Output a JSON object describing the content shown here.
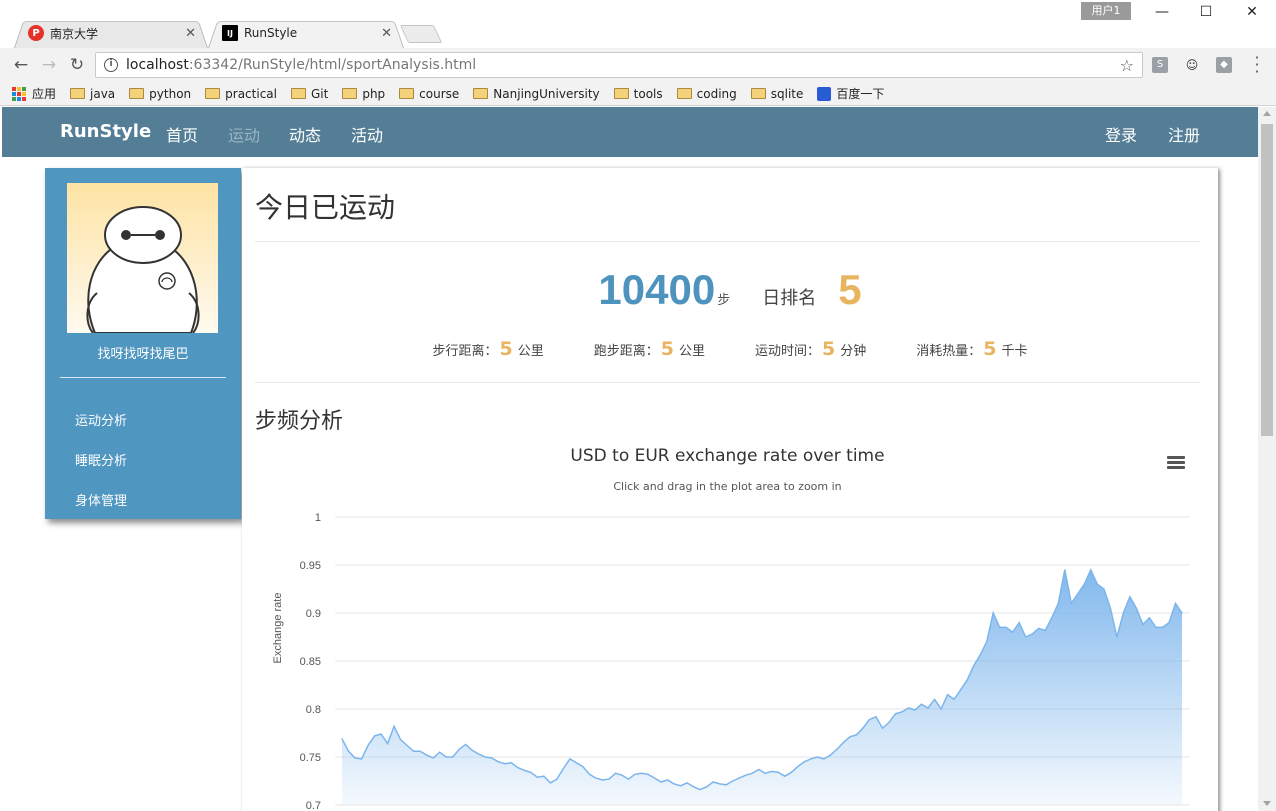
{
  "browser": {
    "tabs": [
      {
        "title": "南京大学",
        "active": false,
        "favicon": "p-icon",
        "favicon_color": "#e5332a"
      },
      {
        "title": "RunStyle",
        "active": true,
        "favicon": "intellij-icon",
        "favicon_color": "#000000"
      }
    ],
    "user_chip": "用户1",
    "url_host": "localhost",
    "url_path": ":63342/RunStyle/html/sportAnalysis.html",
    "bookmarks": [
      {
        "label": "应用",
        "icon": "apps-icon"
      },
      {
        "label": "java",
        "icon": "folder-icon"
      },
      {
        "label": "python",
        "icon": "folder-icon"
      },
      {
        "label": "practical",
        "icon": "folder-icon"
      },
      {
        "label": "Git",
        "icon": "folder-icon"
      },
      {
        "label": "php",
        "icon": "folder-icon"
      },
      {
        "label": "course",
        "icon": "folder-icon"
      },
      {
        "label": "NanjingUniversity",
        "icon": "folder-icon"
      },
      {
        "label": "tools",
        "icon": "folder-icon"
      },
      {
        "label": "coding",
        "icon": "folder-icon"
      },
      {
        "label": "sqlite",
        "icon": "folder-icon"
      },
      {
        "label": "百度一下",
        "icon": "baidu-icon"
      }
    ]
  },
  "nav": {
    "brand": "RunStyle",
    "items": [
      "首页",
      "运动",
      "动态",
      "活动"
    ],
    "current": "运动",
    "login": "登录",
    "register": "注册",
    "bg_color": "#537e96"
  },
  "sidebar": {
    "username": "找呀找呀找尾巴",
    "links": [
      "运动分析",
      "睡眠分析",
      "身体管理"
    ],
    "bg_color": "#4f96c1"
  },
  "main": {
    "title": "今日已运动",
    "steps": "10400",
    "steps_unit": "步",
    "rank_label": "日排名",
    "rank": "5",
    "stats": [
      {
        "label": "步行距离：",
        "value": "5",
        "unit": "公里"
      },
      {
        "label": "跑步距离：",
        "value": "5",
        "unit": "公里"
      },
      {
        "label": "运动时间：",
        "value": "5",
        "unit": "分钟"
      },
      {
        "label": "消耗热量：",
        "value": "5",
        "unit": "千卡"
      }
    ],
    "section_title": "步频分析",
    "accent_blue": "#4e93bd",
    "accent_gold": "#e8b460"
  },
  "chart_data": {
    "type": "area",
    "title": "USD to EUR exchange rate over time",
    "subtitle": "Click and drag in the plot area to zoom in",
    "ylabel": "Exchange rate",
    "xlabel": "",
    "ylim": [
      0.7,
      1.0
    ],
    "yticks": [
      "0.7",
      "0.75",
      "0.8",
      "0.85",
      "0.9",
      "0.95",
      "1"
    ],
    "ytick_values": [
      0.7,
      0.75,
      0.8,
      0.85,
      0.9,
      0.95,
      1.0
    ],
    "grid": true,
    "legend": "none",
    "series": [
      {
        "values": [
          0.769,
          0.756,
          0.749,
          0.748,
          0.762,
          0.772,
          0.774,
          0.764,
          0.782,
          0.768,
          0.762,
          0.756,
          0.756,
          0.752,
          0.749,
          0.755,
          0.75,
          0.75,
          0.758,
          0.763,
          0.757,
          0.753,
          0.75,
          0.749,
          0.745,
          0.743,
          0.744,
          0.739,
          0.736,
          0.734,
          0.729,
          0.73,
          0.723,
          0.727,
          0.738,
          0.748,
          0.744,
          0.74,
          0.732,
          0.728,
          0.726,
          0.727,
          0.733,
          0.731,
          0.727,
          0.732,
          0.733,
          0.732,
          0.728,
          0.724,
          0.726,
          0.722,
          0.72,
          0.723,
          0.719,
          0.716,
          0.719,
          0.724,
          0.722,
          0.721,
          0.725,
          0.728,
          0.731,
          0.733,
          0.737,
          0.733,
          0.735,
          0.734,
          0.73,
          0.734,
          0.74,
          0.745,
          0.748,
          0.75,
          0.748,
          0.752,
          0.758,
          0.765,
          0.771,
          0.773,
          0.78,
          0.789,
          0.792,
          0.78,
          0.786,
          0.795,
          0.797,
          0.801,
          0.799,
          0.805,
          0.801,
          0.81,
          0.8,
          0.815,
          0.81,
          0.82,
          0.83,
          0.845,
          0.856,
          0.87,
          0.9,
          0.885,
          0.885,
          0.88,
          0.89,
          0.875,
          0.878,
          0.884,
          0.882,
          0.895,
          0.91,
          0.945,
          0.91,
          0.92,
          0.93,
          0.945,
          0.93,
          0.925,
          0.905,
          0.875,
          0.9,
          0.917,
          0.905,
          0.888,
          0.895,
          0.885,
          0.885,
          0.89,
          0.91,
          0.9
        ]
      }
    ],
    "fill_color": "#7cb5ec"
  }
}
